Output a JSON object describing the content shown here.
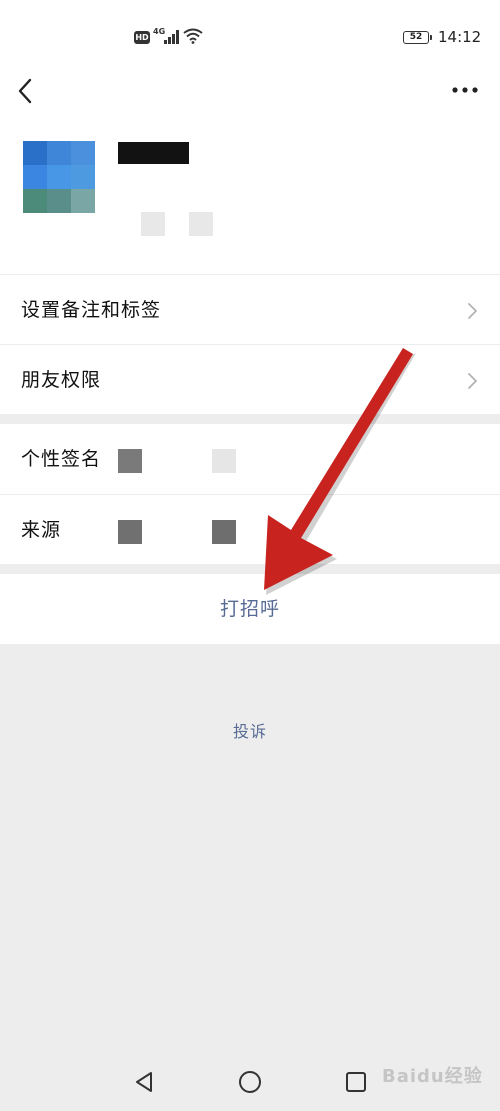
{
  "status_bar": {
    "hd": "HD",
    "network": "4G",
    "battery": "52",
    "time": "14:12"
  },
  "nav": {
    "back_icon": "back-chevron-icon",
    "more_icon": "more-dots-icon"
  },
  "list": {
    "set_remark_label": "设置备注和标签",
    "friend_permission_label": "朋友权限",
    "signature_label": "个性签名",
    "source_label": "来源"
  },
  "actions": {
    "greet_label": "打招呼",
    "complaint_label": "投诉"
  },
  "watermark": "Baidu经验",
  "colors": {
    "link_blue": "#576b95",
    "page_bg": "#ededed",
    "arrow_red": "#c8231f"
  }
}
